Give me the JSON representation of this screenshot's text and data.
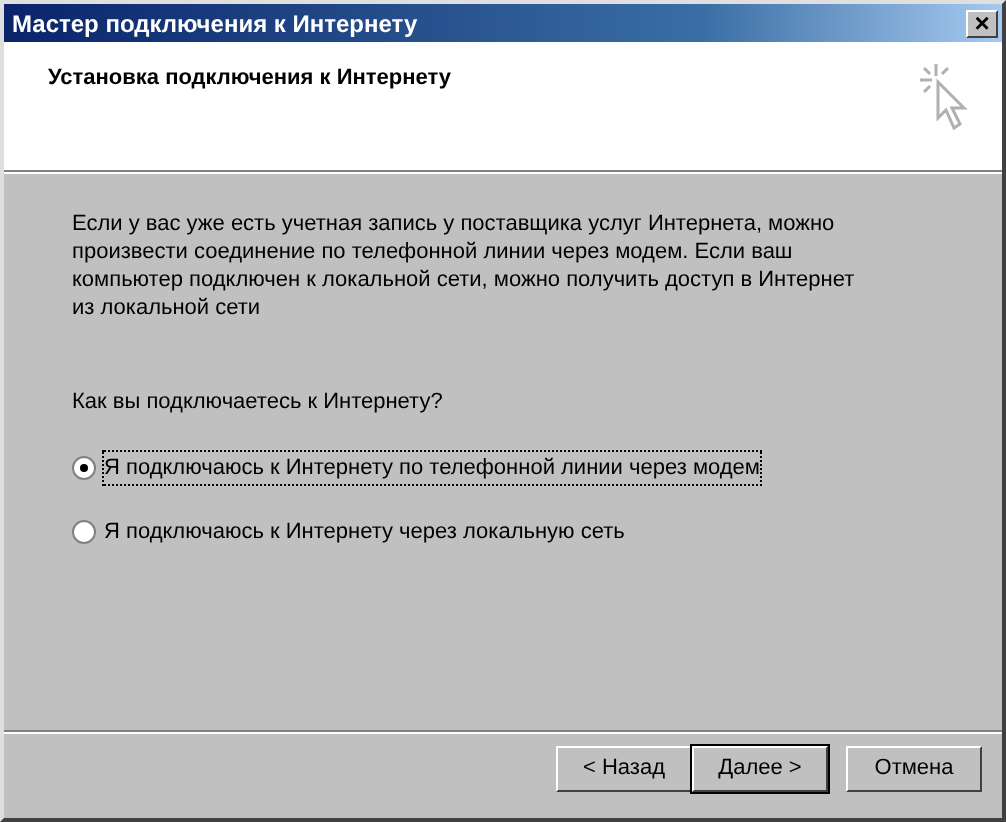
{
  "window": {
    "title": "Мастер подключения к Интернету",
    "close": "×"
  },
  "header": {
    "title": "Установка подключения к Интернету"
  },
  "intro": "Если у вас уже есть учетная запись у поставщика услуг Интернета, можно произвести соединение по телефонной линии через модем. Если ваш компьютер подключен к локальной сети, можно получить доступ в Интернет из локальной сети",
  "question": "Как вы подключаетесь к Интернету?",
  "options": [
    {
      "label": "Я подключаюсь к Интернету по телефонной линии через модем",
      "selected": true
    },
    {
      "label": "Я подключаюсь к Интернету через локальную сеть",
      "selected": false
    }
  ],
  "buttons": [
    {
      "label": "< Назад",
      "default": false
    },
    {
      "label": "Далее >",
      "default": true
    },
    {
      "label": "Отмена",
      "default": false
    }
  ]
}
